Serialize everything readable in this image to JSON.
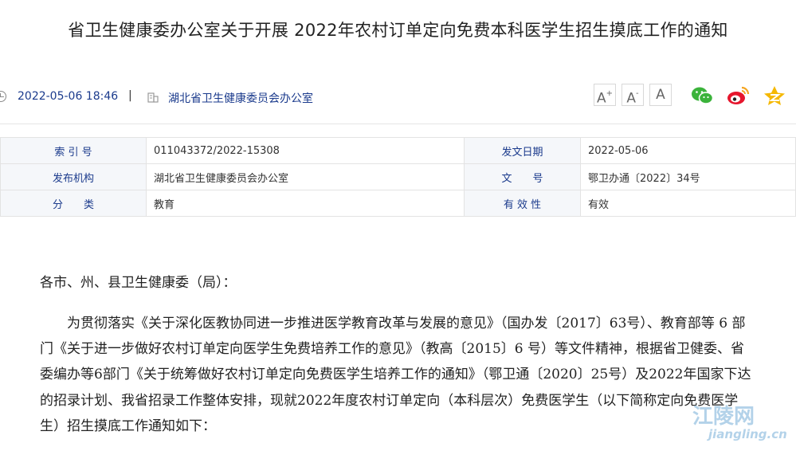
{
  "header": {
    "title": "省卫生健康委办公室关于开展 2022年农村订单定向免费本科医学生招生摸底工作的通知"
  },
  "meta": {
    "date": "2022-05-06 18:46",
    "separator": "|",
    "org": "湖北省卫生健康委员会办公室"
  },
  "font_controls": {
    "increase": "A",
    "increase_mark": "+",
    "decrease": "A",
    "decrease_mark": "-",
    "reset": "A"
  },
  "share": {
    "icons": [
      "wechat-icon",
      "weibo-icon",
      "qzone-icon"
    ],
    "colors": {
      "wechat": "#3bb33b",
      "weibo": "#e6162d",
      "qzone": "#f5b800"
    }
  },
  "info_table": {
    "rows": [
      {
        "label1": "索 引 号",
        "value1": "011043372/2022-15308",
        "label2": "发文日期",
        "value2": "2022-05-06"
      },
      {
        "label1": "发布机构",
        "value1": "湖北省卫生健康委员会办公室",
        "label2": "文　　号",
        "value2": "鄂卫办通〔2022〕34号"
      },
      {
        "label1": "分　　类",
        "value1": "教育",
        "label2": "有 效 性",
        "value2": "有效"
      }
    ]
  },
  "body": {
    "salutation": "各市、州、县卫生健康委（局）：",
    "paragraph": "为贯彻落实《关于深化医教协同进一步推进医学教育改革与发展的意见》（国办发〔2017〕63号）、教育部等 6 部门《关于进一步做好农村订单定向医学生免费培养工作的意见》（教高〔2015〕6 号）等文件精神，根据省卫健委、省委编办等6部门《关于统筹做好农村订单定向免费医学生培养工作的通知》（鄂卫通〔2020〕25号）及2022年国家下达的招录计划、我省招录工作整体安排，现就2022年度农村订单定向（本科层次）免费医学生（以下简称定向免费医学生）招生摸底工作通知如下："
  },
  "watermark": {
    "cn": "江陵网",
    "en": "jiangling.cn"
  }
}
